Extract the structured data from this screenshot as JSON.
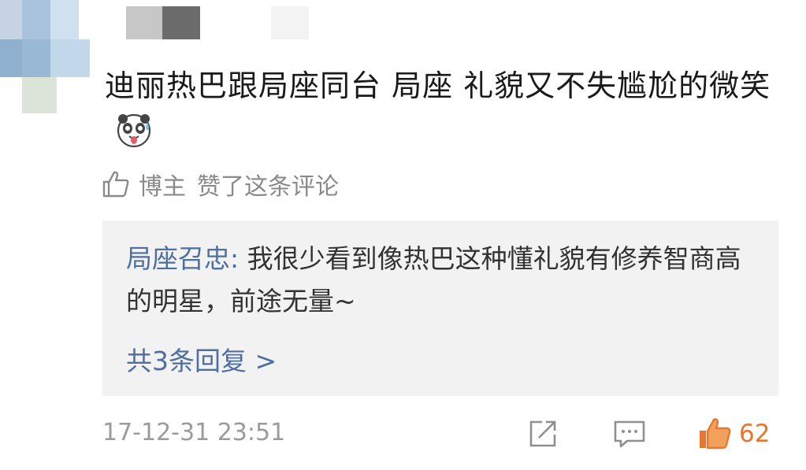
{
  "comment": {
    "text": "迪丽热巴跟局座同台 局座 礼貌又不失尴尬的微笑",
    "emoji_icon": "panda-sweat-emoji"
  },
  "liked_by_author": {
    "blogger_label": "博主",
    "text": "赞了这条评论"
  },
  "reply": {
    "author": "局座召忠:",
    "text": " 我很少看到像热巴这种懂礼貌有修养智商高的明星，前途无量~",
    "more_label": "共3条回复 >"
  },
  "footer": {
    "timestamp": "17-12-31 23:51",
    "like_count": "62",
    "icons": [
      "share-icon",
      "comment-icon",
      "like-icon"
    ]
  },
  "colors": {
    "link": "#4e6fa0",
    "like_active": "#e8772e",
    "reply_bg": "#f2f2f2",
    "muted": "#8a8a8a"
  }
}
